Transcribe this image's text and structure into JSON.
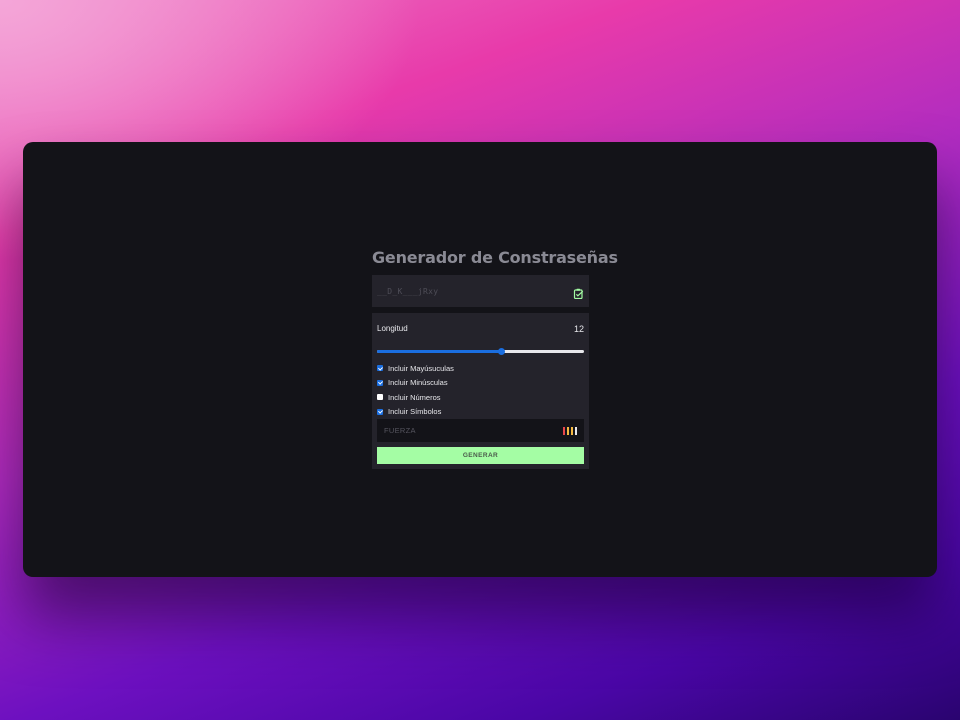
{
  "app": {
    "title": "Generador de Constraseñas"
  },
  "password": {
    "value": "__D_K___jRxy"
  },
  "length": {
    "label": "Longitud",
    "value": "12",
    "slider_fraction": 0.6
  },
  "options": [
    {
      "label": "Incluir Mayúsuculas",
      "checked": true
    },
    {
      "label": "Incluir Minúsculas",
      "checked": true
    },
    {
      "label": "Incluir Números",
      "checked": false
    },
    {
      "label": "Incluir Símbolos",
      "checked": true
    }
  ],
  "strength": {
    "label": "FUERZA",
    "level": 3,
    "max": 4,
    "bar_colors": [
      "#e8474c",
      "#f5b942",
      "#f5b942",
      "#e8e8ec"
    ]
  },
  "generate_button": {
    "label": "GENERAR"
  },
  "colors": {
    "accent_blue": "#1a6ee0",
    "button_green": "#a4fda4",
    "copy_icon_green": "#a4fda4",
    "panel_bg": "#24232b",
    "window_bg": "#131318"
  },
  "icons": {
    "copy": "copy-icon"
  }
}
